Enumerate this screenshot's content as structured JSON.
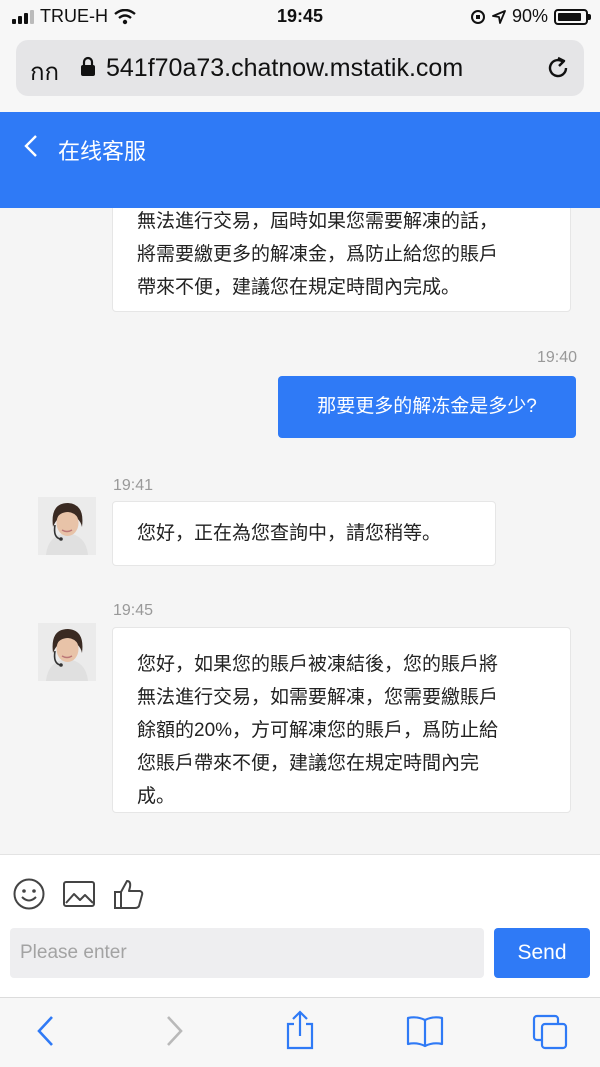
{
  "status_bar": {
    "carrier": "TRUE-H",
    "time": "19:45",
    "battery_percent_label": "90%",
    "battery_level": 0.9
  },
  "url_bar": {
    "reader_label": "กก",
    "url": "541f70a73.chatnow.mstatik.com"
  },
  "header": {
    "title": "在线客服"
  },
  "messages": {
    "m1": {
      "line1": "無法進行交易，屆時如果您需要解凍的話，",
      "line2": "將需要繳更多的解凍金，爲防止給您的賬戶",
      "line3": "帶來不便，建議您在規定時間內完成。"
    },
    "m2": {
      "time": "19:40",
      "text": "那要更多的解冻金是多少?"
    },
    "m3": {
      "time": "19:41",
      "text": "您好，正在為您查詢中，請您稍等。"
    },
    "m4": {
      "time": "19:45",
      "line1": "您好，如果您的賬戶被凍結後，您的賬戶將",
      "line2": "無法進行交易，如需要解凍，您需要繳賬戶",
      "line3": "餘額的20%，方可解凍您的賬戶，爲防止給",
      "line4": "您賬戶帶來不便，建議您在規定時間內完",
      "line5": "成。"
    }
  },
  "composer": {
    "placeholder": "Please enter",
    "send_label": "Send",
    "tool_icons": [
      "emoji-icon",
      "image-icon",
      "thumbs-up-icon"
    ]
  },
  "safari_toolbar": {
    "icons": [
      "back-icon",
      "forward-icon",
      "share-icon",
      "bookmarks-icon",
      "tabs-icon"
    ]
  },
  "colors": {
    "accent": "#2f7af6"
  }
}
